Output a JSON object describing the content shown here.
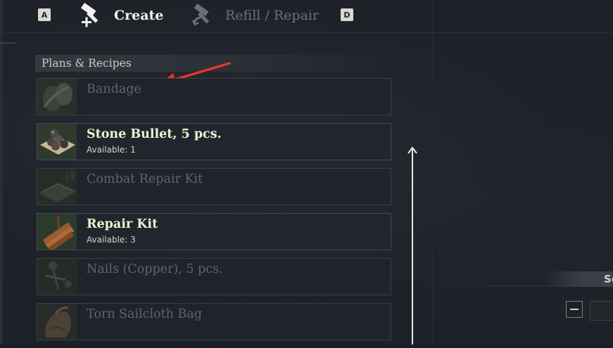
{
  "header": {
    "key_left": "A",
    "key_right": "D",
    "tabs": [
      {
        "label": "Create",
        "active": true,
        "icon": "hammer-plus-icon"
      },
      {
        "label": "Refill / Repair",
        "active": false,
        "icon": "hammer-repair-icon"
      }
    ]
  },
  "section": {
    "title": "Plans & Recipes"
  },
  "recipes": [
    {
      "name": "Bandage",
      "available": "",
      "enabled": false,
      "icon": "bandage-icon"
    },
    {
      "name": "Stone Bullet, 5 pcs.",
      "available": "Available: 1",
      "enabled": true,
      "icon": "stone-bullet-icon"
    },
    {
      "name": "Combat Repair Kit",
      "available": "",
      "enabled": false,
      "icon": "combat-repair-kit-icon"
    },
    {
      "name": "Repair Kit",
      "available": "Available: 3",
      "enabled": true,
      "icon": "repair-kit-icon"
    },
    {
      "name": "Nails (Copper), 5 pcs.",
      "available": "",
      "enabled": false,
      "icon": "copper-nails-icon"
    },
    {
      "name": "Torn Sailcloth Bag",
      "available": "",
      "enabled": false,
      "icon": "sailcloth-bag-icon"
    }
  ],
  "right_panel": {
    "partial_label": "Se"
  },
  "colors": {
    "background": "#1d2127",
    "enabled_text": "#e8f5cf",
    "disabled_text": "#5f656b",
    "annotation_arrow": "#e8352c"
  }
}
